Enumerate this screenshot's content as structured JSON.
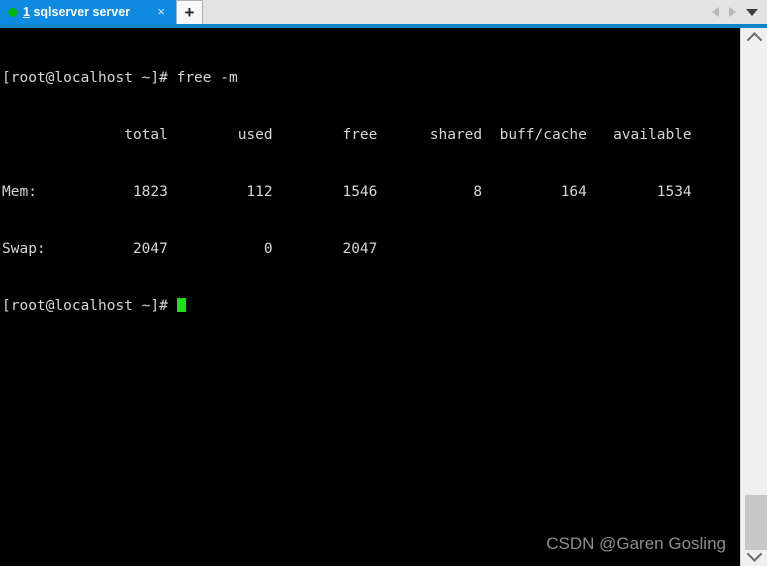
{
  "window": {
    "accent_color": "#0e8ae0",
    "underline_color": "#1184c8",
    "tabbar_bg": "#e3e3e3"
  },
  "tabbar": {
    "tabs": [
      {
        "index": "1",
        "title": "sqlserver server",
        "status_dot_color": "#00b906",
        "close_label": "×",
        "active": true
      }
    ],
    "new_tab_label": "+",
    "nav_prev_name": "previous-tab-arrow",
    "nav_next_name": "next-tab-arrow",
    "tab_list_label": "▾"
  },
  "terminal": {
    "background": "#000000",
    "foreground": "#d6d6d6",
    "cursor_color": "#16e216",
    "prompt": "[root@localhost ~]#",
    "command": "free -m",
    "lines": [
      "[root@localhost ~]# free -m",
      "              total        used        free      shared  buff/cache   available",
      "Mem:           1823         112        1546           8         164        1534",
      "Swap:          2047           0        2047",
      "[root@localhost ~]# "
    ],
    "memory_table": {
      "columns": [
        "",
        "total",
        "used",
        "free",
        "shared",
        "buff/cache",
        "available"
      ],
      "rows": [
        [
          "Mem:",
          "1823",
          "112",
          "1546",
          "8",
          "164",
          "1534"
        ],
        [
          "Swap:",
          "2047",
          "0",
          "2047",
          "",
          "",
          ""
        ]
      ]
    }
  },
  "watermark": {
    "text": "CSDN @Garen Gosling",
    "color": "#8e8e8e"
  },
  "scrollbar": {
    "up_arrow": "∧",
    "down_arrow": "∨",
    "thumb_name": "scrollbar-thumb"
  }
}
